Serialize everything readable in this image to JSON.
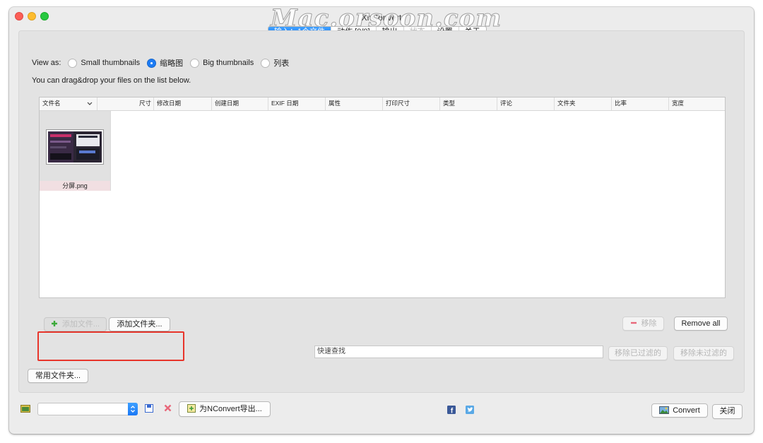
{
  "window": {
    "title": "XnConvert",
    "watermark": "Mac.orsoon.com"
  },
  "tabs": [
    {
      "label": "输入：1个文件",
      "state": "active"
    },
    {
      "label": "动作 [0/0]",
      "state": "normal"
    },
    {
      "label": "输出",
      "state": "normal"
    },
    {
      "label": "状态",
      "state": "disabled"
    },
    {
      "label": "设置",
      "state": "normal"
    },
    {
      "label": "关于",
      "state": "normal"
    }
  ],
  "view": {
    "label": "View as:",
    "options": [
      {
        "label": "Small thumbnails",
        "selected": false
      },
      {
        "label": "缩略图",
        "selected": true
      },
      {
        "label": "Big thumbnails",
        "selected": false
      },
      {
        "label": "列表",
        "selected": false
      }
    ],
    "hint": "You can drag&drop your files on the list below."
  },
  "file_list": {
    "columns": [
      "文件名",
      "尺寸",
      "修改日期",
      "创建日期",
      "EXIF 日期",
      "属性",
      "打印尺寸",
      "类型",
      "评论",
      "文件夹",
      "比率",
      "宽度"
    ],
    "sort_indicator": "chevron-down-icon",
    "files": [
      {
        "name": "分屏.png"
      }
    ]
  },
  "actions": {
    "add_files": "添加文件...",
    "add_folder": "添加文件夹...",
    "remove": "移除",
    "remove_all": "Remove all",
    "search_placeholder": "快速查找",
    "remove_filtered": "移除已过滤的",
    "remove_unfiltered": "移除未过滤的",
    "favorite_folders": "常用文件夹..."
  },
  "bottom": {
    "export_label": "为NConvert导出...",
    "convert_label": "Convert",
    "close_label": "关闭"
  },
  "colors": {
    "accent": "#1b78f5",
    "highlight_box": "#e8352b",
    "remove_icon": "#e8677a"
  }
}
